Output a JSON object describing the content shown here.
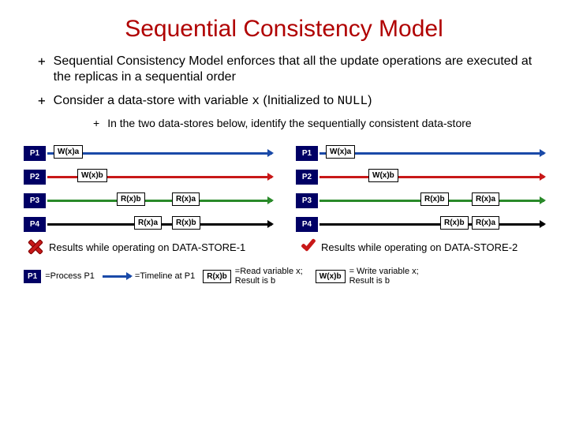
{
  "title": "Sequential Consistency Model",
  "bullets": {
    "b1": "Sequential Consistency Model enforces that all the update operations are executed at the replicas in a sequential order",
    "b2_pre": "Consider a data-store with variable ",
    "b2_var": "x",
    "b2_mid": " (Initialized to ",
    "b2_null": "NULL",
    "b2_post": ")",
    "sub1": "In the two data-stores below, identify the sequentially consistent data-store"
  },
  "ds1": {
    "row1": {
      "p": "P1",
      "ops": {
        "op1": "W(x)a"
      }
    },
    "row2": {
      "p": "P2",
      "ops": {
        "op1": "W(x)b"
      }
    },
    "row3": {
      "p": "P3",
      "ops": {
        "op1": "R(x)b",
        "op2": "R(x)a"
      }
    },
    "row4": {
      "p": "P4",
      "ops": {
        "op1": "R(x)a",
        "op2": "R(x)b"
      }
    },
    "caption": "Results while operating on DATA-STORE-1"
  },
  "ds2": {
    "row1": {
      "p": "P1",
      "ops": {
        "op1": "W(x)a"
      }
    },
    "row2": {
      "p": "P2",
      "ops": {
        "op1": "W(x)b"
      }
    },
    "row3": {
      "p": "P3",
      "ops": {
        "op1": "R(x)b",
        "op2": "R(x)a"
      }
    },
    "row4": {
      "p": "P4",
      "ops": {
        "op1": "R(x)b",
        "op2": "R(x)a"
      }
    },
    "caption": "Results while operating on DATA-STORE-2"
  },
  "legend": {
    "proc_box": "P1",
    "proc_text": "=Process P1",
    "arrow_text": "=Timeline at P1",
    "read_box": "R(x)b",
    "read_text": "=Read variable x; Result is b",
    "write_box": "W(x)b",
    "write_text": "= Write variable x; Result is b"
  }
}
